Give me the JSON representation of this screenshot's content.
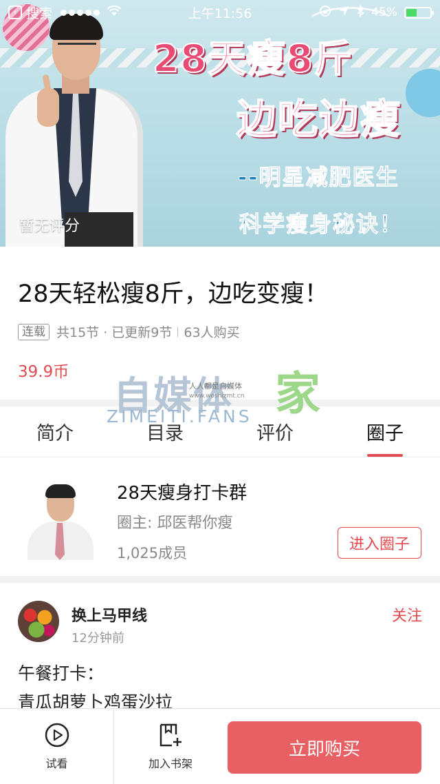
{
  "status_bar": {
    "back_app": "搜索",
    "time": "上午11:56",
    "battery": "45%",
    "battery_level": 0.45
  },
  "banner": {
    "title_line1": "28天瘦8斤",
    "title_line2": "边吃边瘦",
    "title_line3": "--明星减肥医生",
    "title_line4": "科学瘦身秘诀！",
    "rating": "暂无评分"
  },
  "course": {
    "title": "28天轻松瘦8斤，边吃变瘦！",
    "tag": "连载",
    "sections": "共15节 · 已更新9节",
    "buyers": "63人购买",
    "price": "39.9币"
  },
  "watermark": {
    "main": "自媒体",
    "home": "家",
    "sub": "ZIMEITI.FANS",
    "tiny": "人人都是自媒体",
    "url": "www.woshizmt.cn"
  },
  "tabs": [
    {
      "label": "简介"
    },
    {
      "label": "目录"
    },
    {
      "label": "评价"
    },
    {
      "label": "圈子"
    }
  ],
  "group": {
    "name": "28天瘦身打卡群",
    "owner": "圈主: 邱医帮你瘦",
    "members": "1,025成员",
    "join_label": "进入圈子"
  },
  "post": {
    "user": "换上马甲线",
    "time": "12分钟前",
    "follow_label": "关注",
    "line1": "午餐打卡：",
    "line2": "青瓜胡萝卜鸡蛋沙拉"
  },
  "bottom_bar": {
    "trial_label": "试看",
    "shelf_label": "加入书架",
    "buy_label": "立即购买"
  },
  "colors": {
    "accent": "#e14b50",
    "buy_button": "#e86063"
  }
}
